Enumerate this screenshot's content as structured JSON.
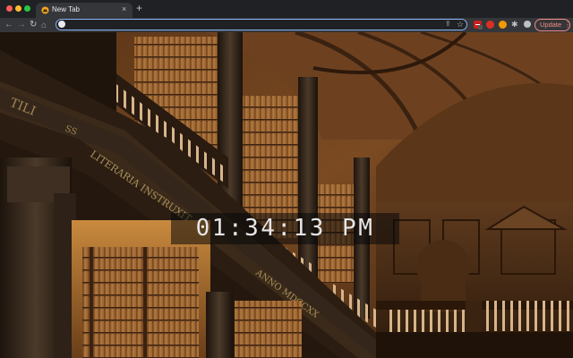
{
  "window": {
    "traffic_lights": {
      "close": "#ff5f57",
      "minimize": "#febc2e",
      "zoom": "#28c840"
    }
  },
  "tab": {
    "title": "New Tab",
    "favicon": "momentum-icon",
    "close_glyph": "×"
  },
  "new_tab_glyph": "+",
  "toolbar": {
    "back_glyph": "←",
    "forward_glyph": "→",
    "reload_glyph": "↻",
    "home_glyph": "⌂",
    "address_value": "",
    "share_glyph": "⇪",
    "star_glyph": "☆",
    "extensions_glyph": "✱",
    "update_label": "Update",
    "menu_glyph": "⋮",
    "accent": "#8ab4f8"
  },
  "clock": {
    "time": "01:34:13 PM"
  }
}
